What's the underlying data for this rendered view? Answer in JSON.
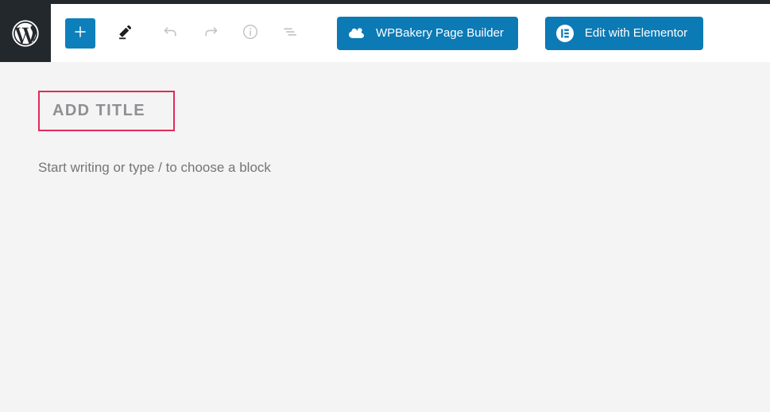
{
  "window": {
    "app_name": "WordPress Block Editor",
    "background_color": "#f4f4f5",
    "header_background": "#ffffff",
    "admin_bar_color": "#23282d"
  },
  "header": {
    "logo": {
      "icon": "wordpress-logo-icon",
      "background": "#23282d",
      "color": "#ffffff"
    },
    "tools": [
      {
        "id": "inserter",
        "icon": "plus-icon",
        "label": "Toggle block inserter",
        "style": "primary",
        "color": "#0d7fbb"
      },
      {
        "id": "edit-mode",
        "icon": "pencil-icon",
        "label": "Tools",
        "style": "plain",
        "color": "#1e1e1e"
      },
      {
        "id": "undo",
        "icon": "undo-arrow-icon",
        "label": "Undo",
        "style": "plain",
        "color": "#c4c4c4"
      },
      {
        "id": "redo",
        "icon": "redo-arrow-icon",
        "label": "Redo",
        "style": "plain",
        "color": "#c4c4c4"
      },
      {
        "id": "details",
        "icon": "info-circle-icon",
        "label": "Details",
        "style": "plain",
        "color": "#c4c4c4"
      },
      {
        "id": "list-view",
        "icon": "list-view-icon",
        "label": "List View",
        "style": "plain",
        "color": "#c4c4c4"
      }
    ],
    "builder_buttons": [
      {
        "id": "wpbakery",
        "label": "WPBakery Page Builder",
        "icon": "wpbakery-cloud-icon",
        "background": "#0c7ab5",
        "text_color": "#ffffff"
      },
      {
        "id": "elementor",
        "label": "Edit with Elementor",
        "icon": "elementor-logo-icon",
        "background": "#0c7ab5",
        "text_color": "#ffffff"
      }
    ]
  },
  "editor": {
    "title": {
      "placeholder": "Add title",
      "display_text": "ADD TITLE",
      "text_color": "#8f8f94",
      "highlight_border_color": "#e12b57"
    },
    "paragraph": {
      "placeholder": "Start writing or type / to choose a block",
      "text_color": "#757575"
    }
  }
}
